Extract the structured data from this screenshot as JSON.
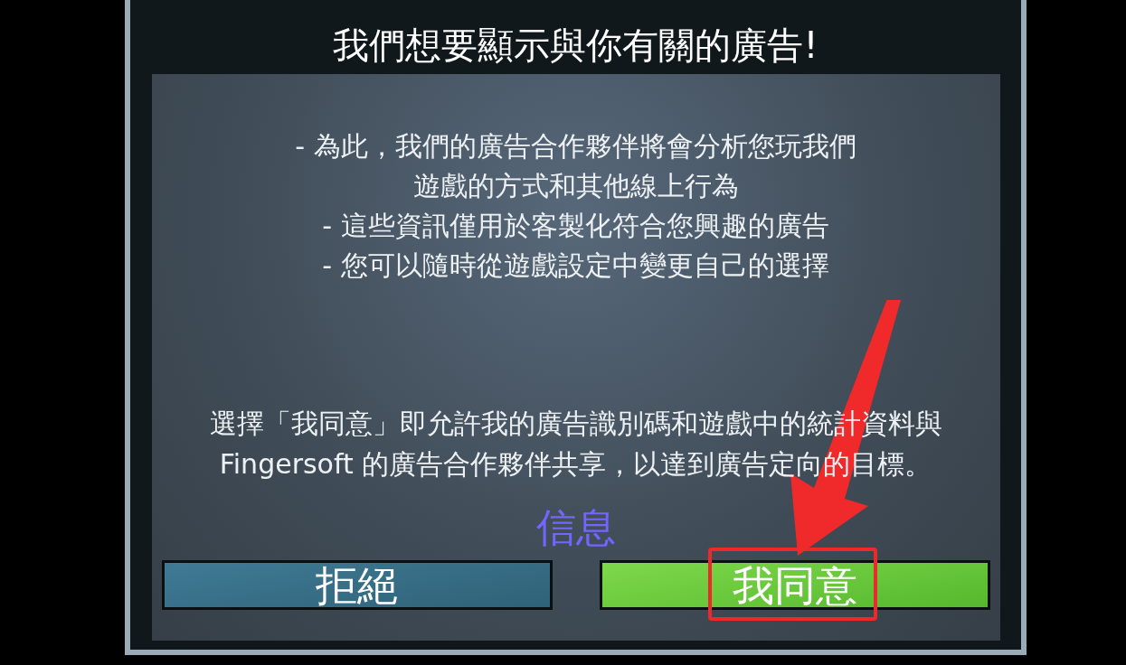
{
  "dialog": {
    "title": "我們想要顯示與你有關的廣告!",
    "bullet_lines": [
      "- 為此，我們的廣告合作夥伴將會分析您玩我們",
      "遊戲的方式和其他線上行為",
      "- 這些資訊僅用於客製化符合您興趣的廣告",
      "- 您可以隨時從遊戲設定中變更自己的選擇"
    ],
    "consent_lines": [
      "選擇「我同意」即允許我的廣告識別碼和遊戲中的統計資料與",
      "Fingersoft 的廣告合作夥伴共享，以達到廣告定向的目標。"
    ],
    "info_link": "信息",
    "buttons": [
      {
        "label": "拒絕",
        "kind": "decline",
        "highlighted": false
      },
      {
        "label": "我同意",
        "kind": "accept",
        "highlighted": true
      }
    ]
  }
}
